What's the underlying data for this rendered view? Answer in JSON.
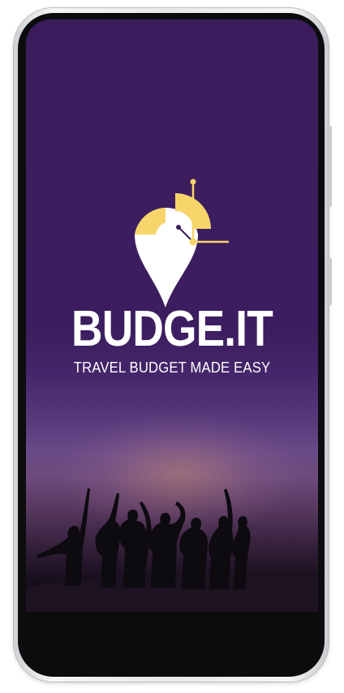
{
  "app": {
    "name": "BUDGE.IT",
    "tagline": "TRAVEL BUDGET MADE EASY"
  },
  "logo": {
    "icon": "location-pin-with-clock-icon",
    "pin_color": "#ffffff",
    "accent_color": "#f7d56a"
  },
  "background": {
    "image": "group-silhouette-at-sunset",
    "top_color": "#3b1d5e",
    "glow_color": "#c99a86"
  }
}
